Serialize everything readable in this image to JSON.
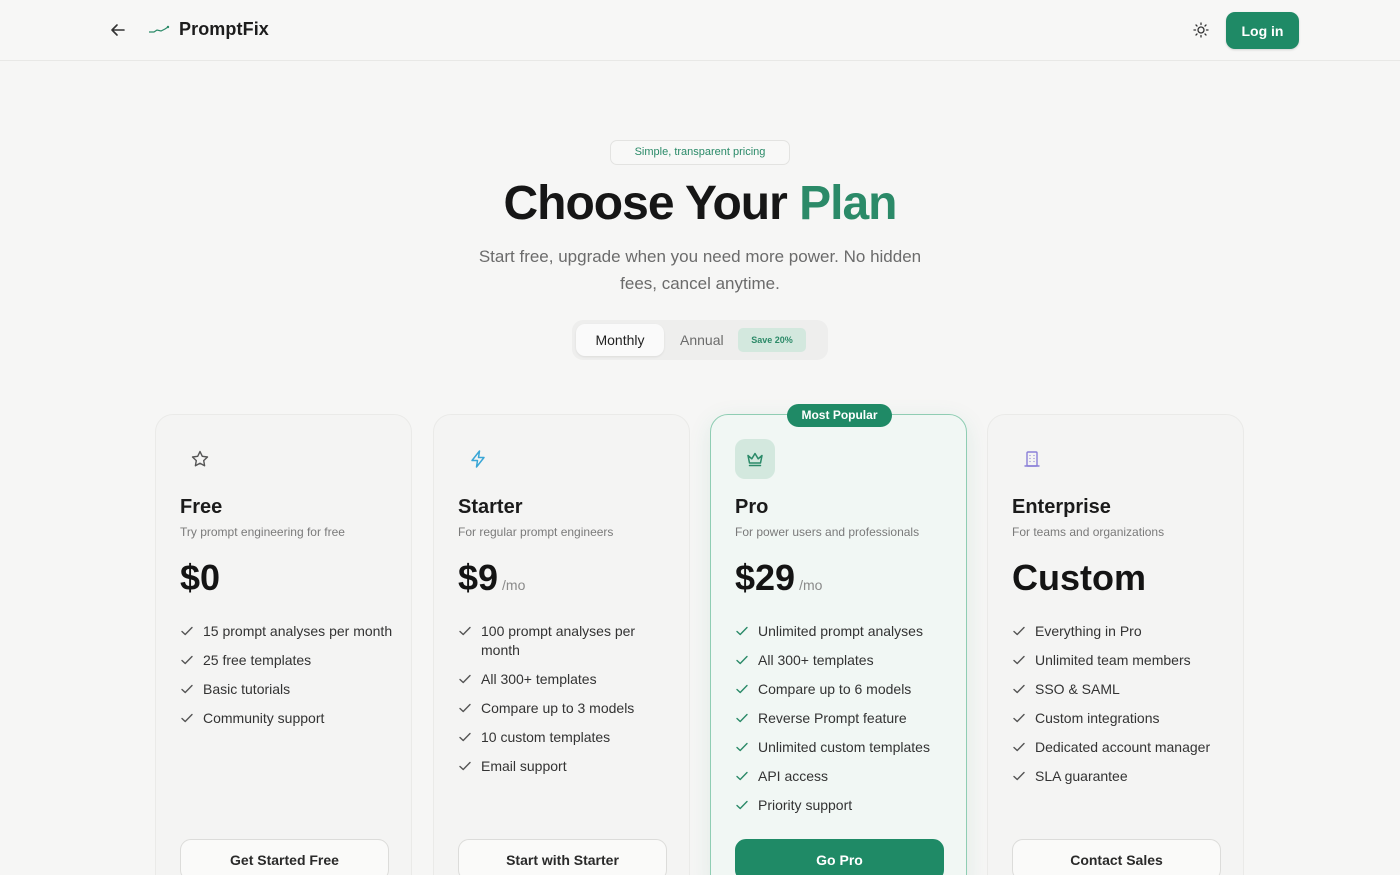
{
  "header": {
    "back_icon": "arrow-left-icon",
    "brand": "PromptFix",
    "theme_icon": "sun-icon",
    "login_label": "Log in"
  },
  "hero": {
    "pill": "Simple, transparent pricing",
    "title_main": "Choose Your",
    "title_accent": "Plan",
    "subtitle": "Start free, upgrade when you need more power. No hidden fees, cancel anytime."
  },
  "billing_toggle": {
    "options": [
      "Monthly",
      "Annual"
    ],
    "selected": "Monthly",
    "save_badge": "Save 20%"
  },
  "colors": {
    "accent": "#1f8a66",
    "accent_soft": "#d3e8de",
    "background": "#f6f6f5"
  },
  "plans": [
    {
      "icon": "star-icon",
      "name": "Free",
      "description": "Try prompt engineering for free",
      "price": "$0",
      "unit": "",
      "features": [
        "15 prompt analyses per month",
        "25 free templates",
        "Basic tutorials",
        "Community support"
      ],
      "cta": "Get Started Free"
    },
    {
      "icon": "lightning-icon",
      "name": "Starter",
      "description": "For regular prompt engineers",
      "price": "$9",
      "unit": "/mo",
      "features": [
        "100 prompt analyses per month",
        "All 300+ templates",
        "Compare up to 3 models",
        "10 custom templates",
        "Email support"
      ],
      "cta": "Start with Starter"
    },
    {
      "icon": "crown-icon",
      "name": "Pro",
      "badge": "Most Popular",
      "description": "For power users and professionals",
      "price": "$29",
      "unit": "/mo",
      "features": [
        "Unlimited prompt analyses",
        "All 300+ templates",
        "Compare up to 6 models",
        "Reverse Prompt feature",
        "Unlimited custom templates",
        "API access",
        "Priority support"
      ],
      "cta": "Go Pro"
    },
    {
      "icon": "building-icon",
      "name": "Enterprise",
      "description": "For teams and organizations",
      "price": "Custom",
      "unit": "",
      "features": [
        "Everything in Pro",
        "Unlimited team members",
        "SSO & SAML",
        "Custom integrations",
        "Dedicated account manager",
        "SLA guarantee"
      ],
      "cta": "Contact Sales"
    }
  ]
}
